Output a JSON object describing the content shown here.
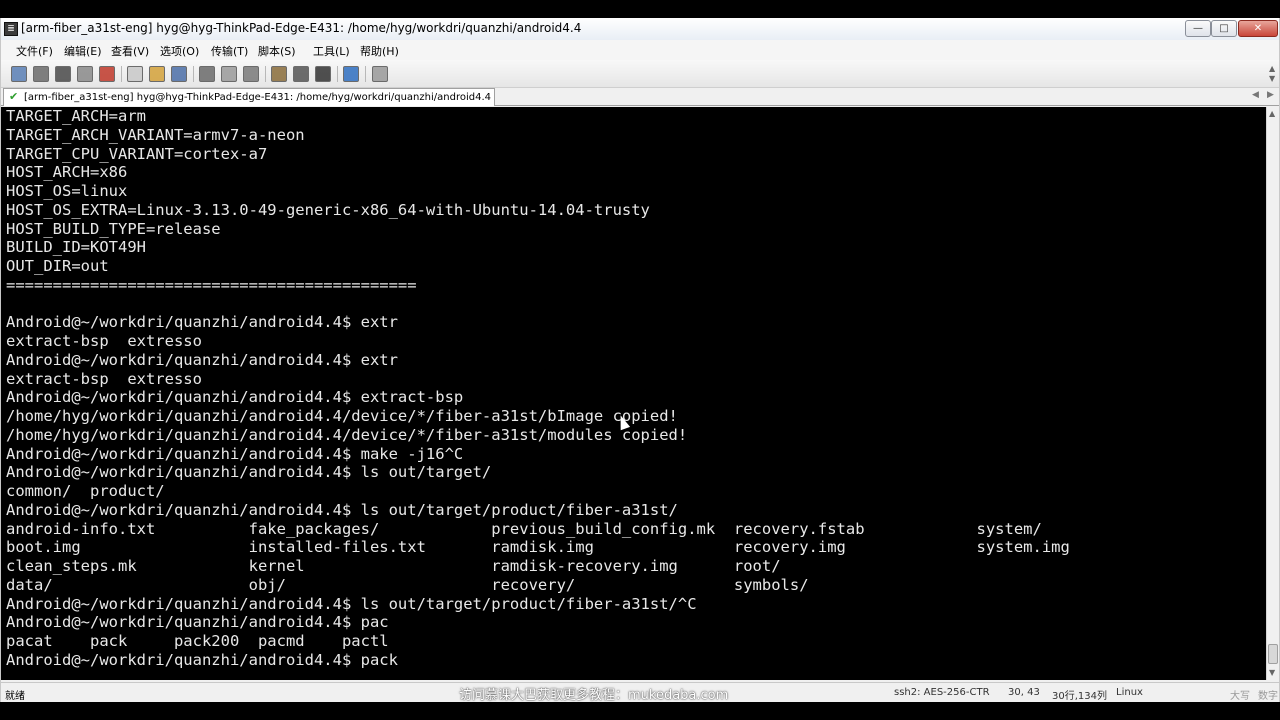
{
  "window": {
    "title": "[arm-fiber_a31st-eng] hyg@hyg-ThinkPad-Edge-E431: /home/hyg/workdri/quanzhi/android4.4",
    "app_icon_glyph": "≣",
    "minimize_glyph": "—",
    "maximize_glyph": "□",
    "close_glyph": "✕"
  },
  "menu": [
    "文件(F)",
    "编辑(E)",
    "查看(V)",
    "选项(O)",
    "传输(T)",
    "脚本(S)",
    "工具(L)",
    "帮助(H)"
  ],
  "toolbar": {
    "buttons": [
      {
        "icon": "new-session-icon",
        "color": "#5a7fb5"
      },
      {
        "icon": "open-session-icon",
        "color": "#6b6b6b"
      },
      {
        "icon": "reconnect-icon",
        "color": "#4a4a4a"
      },
      {
        "icon": "clone-session-icon",
        "color": "#8a8a8a"
      },
      {
        "icon": "disconnect-icon",
        "color": "#c0392b"
      },
      {
        "icon": "copy-icon",
        "color": "#c9c9c9"
      },
      {
        "icon": "paste-icon",
        "color": "#d4a23a"
      },
      {
        "icon": "find-icon",
        "color": "#4c6fa8"
      },
      {
        "icon": "print-icon",
        "color": "#6b6b6b"
      },
      {
        "icon": "print-setup-icon",
        "color": "#9a9a9a"
      },
      {
        "icon": "page-icon",
        "color": "#7a7a7a"
      },
      {
        "icon": "transfer-icon",
        "color": "#8a6d3b"
      },
      {
        "icon": "settings-icon",
        "color": "#555555"
      },
      {
        "icon": "keymap-icon",
        "color": "#333333"
      },
      {
        "icon": "help-icon",
        "color": "#2f6fc1"
      },
      {
        "icon": "screenshot-icon",
        "color": "#9a9a9a"
      }
    ]
  },
  "tab": {
    "label": "[arm-fiber_a31st-eng] hyg@hyg-ThinkPad-Edge-E431: /home/hyg/workdri/quanzhi/android4.4",
    "check_glyph": "✔",
    "prev_glyph": "◀",
    "next_glyph": "▶"
  },
  "terminal": {
    "lines": [
      "TARGET_ARCH=arm",
      "TARGET_ARCH_VARIANT=armv7-a-neon",
      "TARGET_CPU_VARIANT=cortex-a7",
      "HOST_ARCH=x86",
      "HOST_OS=linux",
      "HOST_OS_EXTRA=Linux-3.13.0-49-generic-x86_64-with-Ubuntu-14.04-trusty",
      "HOST_BUILD_TYPE=release",
      "BUILD_ID=KOT49H",
      "OUT_DIR=out",
      "============================================",
      "",
      "Android@~/workdri/quanzhi/android4.4$ extr",
      "extract-bsp  extresso",
      "Android@~/workdri/quanzhi/android4.4$ extr",
      "extract-bsp  extresso",
      "Android@~/workdri/quanzhi/android4.4$ extract-bsp",
      "/home/hyg/workdri/quanzhi/android4.4/device/*/fiber-a31st/bImage copied!",
      "/home/hyg/workdri/quanzhi/android4.4/device/*/fiber-a31st/modules copied!",
      "Android@~/workdri/quanzhi/android4.4$ make -j16^C",
      "Android@~/workdri/quanzhi/android4.4$ ls out/target/",
      "common/  product/",
      "Android@~/workdri/quanzhi/android4.4$ ls out/target/product/fiber-a31st/",
      "android-info.txt          fake_packages/            previous_build_config.mk  recovery.fstab            system/",
      "boot.img                  installed-files.txt       ramdisk.img               recovery.img              system.img",
      "clean_steps.mk            kernel                    ramdisk-recovery.img      root/",
      "data/                     obj/                      recovery/                 symbols/",
      "Android@~/workdri/quanzhi/android4.4$ ls out/target/product/fiber-a31st/^C",
      "Android@~/workdri/quanzhi/android4.4$ pac",
      "pacat    pack     pack200  pacmd    pactl",
      "Android@~/workdri/quanzhi/android4.4$ pack"
    ]
  },
  "statusbar": {
    "ready": "就绪",
    "watermark": "访问慕课大巴获取更多教程：mukedaba.com",
    "cipher": "ssh2: AES-256-CTR",
    "cursor_pos": "30,  43",
    "dimensions": "30行,134列",
    "term_type": "Linux",
    "caps": "大写",
    "num": "数字"
  }
}
